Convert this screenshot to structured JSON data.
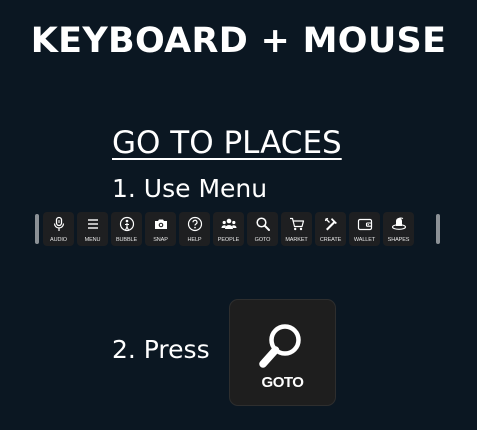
{
  "title": "KEYBOARD + MOUSE",
  "section_title": "GO TO PLACES",
  "step1": "1. Use Menu",
  "step2": "2. Press",
  "menu": {
    "items": [
      {
        "label": "AUDIO",
        "icon": "microphone-icon"
      },
      {
        "label": "MENU",
        "icon": "hamburger-icon"
      },
      {
        "label": "BUBBLE",
        "icon": "bubble-icon"
      },
      {
        "label": "SNAP",
        "icon": "camera-icon"
      },
      {
        "label": "HELP",
        "icon": "help-icon"
      },
      {
        "label": "PEOPLE",
        "icon": "people-icon"
      },
      {
        "label": "GOTO",
        "icon": "search-icon"
      },
      {
        "label": "MARKET",
        "icon": "cart-icon"
      },
      {
        "label": "CREATE",
        "icon": "create-icon"
      },
      {
        "label": "WALLET",
        "icon": "wallet-icon"
      },
      {
        "label": "SHAPES",
        "icon": "shapes-icon"
      }
    ]
  },
  "goto_button": {
    "label": "GOTO",
    "icon": "search-icon"
  },
  "colors": {
    "background": "#0b1722",
    "button": "#1e1f21",
    "text": "#ffffff"
  }
}
